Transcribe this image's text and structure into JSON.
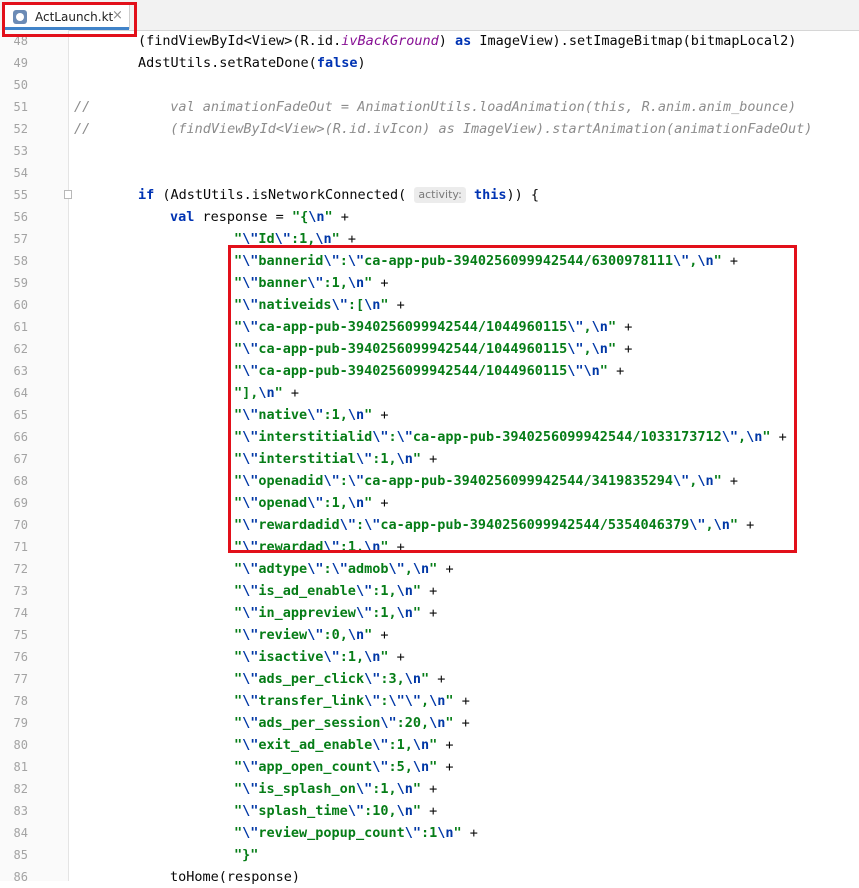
{
  "tab": {
    "filename": "ActLaunch.kt",
    "close": "×"
  },
  "lines": [
    {
      "n": "48",
      "parts": [
        [
          "",
          "(findViewById<View>(R.id."
        ],
        [
          "ital",
          "ivBackGround"
        ],
        [
          "",
          ") "
        ],
        [
          "kw",
          "as"
        ],
        [
          "",
          " ImageView).setImageBitmap(bitmapLocal2)"
        ]
      ]
    },
    {
      "n": "49",
      "parts": [
        [
          "",
          "AdstUtils.setRateDone("
        ],
        [
          "kw",
          "false"
        ],
        [
          "",
          ")"
        ]
      ]
    },
    {
      "n": "50",
      "parts": []
    },
    {
      "n": "51",
      "comment": "//",
      "parts": [
        [
          "cmt",
          "  val animationFadeOut = AnimationUtils.loadAnimation(this, R.anim.anim_bounce)"
        ]
      ]
    },
    {
      "n": "52",
      "comment": "//",
      "parts": [
        [
          "cmt",
          "  (findViewById<View>(R.id.ivIcon) as ImageView).startAnimation(animationFadeOut)"
        ]
      ]
    },
    {
      "n": "53",
      "parts": []
    },
    {
      "n": "54",
      "parts": []
    },
    {
      "n": "55",
      "fold": true,
      "parts": [
        [
          "kw",
          "if"
        ],
        [
          "",
          " (AdstUtils.isNetworkConnected( "
        ],
        [
          "hint",
          "activity:"
        ],
        [
          "",
          ""
        ],
        [
          "kw",
          " this"
        ],
        [
          "",
          "))"
        ],
        [
          "",
          " {"
        ]
      ]
    },
    {
      "n": "56",
      "indent": 1,
      "parts": [
        [
          "kw",
          "val"
        ],
        [
          "",
          " response = "
        ],
        [
          "str",
          "\"{"
        ],
        [
          "esc",
          "\\n"
        ],
        [
          "str",
          "\""
        ],
        [
          "",
          " +"
        ]
      ]
    },
    {
      "n": "57",
      "indent": 3,
      "parts": [
        [
          "str",
          "\""
        ],
        [
          "esc",
          "\\\""
        ],
        [
          "str",
          "Id"
        ],
        [
          "esc",
          "\\\""
        ],
        [
          "str",
          ":1,"
        ],
        [
          "esc",
          "\\n"
        ],
        [
          "str",
          "\""
        ],
        [
          "",
          " +"
        ]
      ]
    },
    {
      "n": "58",
      "indent": 3,
      "parts": [
        [
          "str",
          "\""
        ],
        [
          "esc",
          "\\\""
        ],
        [
          "str",
          "bannerid"
        ],
        [
          "esc",
          "\\\""
        ],
        [
          "str",
          ":"
        ],
        [
          "esc",
          "\\\""
        ],
        [
          "str",
          "ca-app-pub-3940256099942544/6300978111"
        ],
        [
          "esc",
          "\\\""
        ],
        [
          "str",
          ","
        ],
        [
          "esc",
          "\\n"
        ],
        [
          "str",
          "\""
        ],
        [
          "",
          " +"
        ]
      ]
    },
    {
      "n": "59",
      "indent": 3,
      "parts": [
        [
          "str",
          "\""
        ],
        [
          "esc",
          "\\\""
        ],
        [
          "str",
          "banner"
        ],
        [
          "esc",
          "\\\""
        ],
        [
          "str",
          ":1,"
        ],
        [
          "esc",
          "\\n"
        ],
        [
          "str",
          "\""
        ],
        [
          "",
          " +"
        ]
      ]
    },
    {
      "n": "60",
      "indent": 3,
      "parts": [
        [
          "str",
          "\""
        ],
        [
          "esc",
          "\\\""
        ],
        [
          "str",
          "nativeids"
        ],
        [
          "esc",
          "\\\""
        ],
        [
          "str",
          ":["
        ],
        [
          "esc",
          "\\n"
        ],
        [
          "str",
          "\""
        ],
        [
          "",
          " +"
        ]
      ]
    },
    {
      "n": "61",
      "indent": 3,
      "parts": [
        [
          "str",
          "\""
        ],
        [
          "esc",
          "\\\""
        ],
        [
          "str",
          "ca-app-pub-3940256099942544/1044960115"
        ],
        [
          "esc",
          "\\\""
        ],
        [
          "str",
          ","
        ],
        [
          "esc",
          "\\n"
        ],
        [
          "str",
          "\""
        ],
        [
          "",
          " +"
        ]
      ]
    },
    {
      "n": "62",
      "indent": 3,
      "parts": [
        [
          "str",
          "\""
        ],
        [
          "esc",
          "\\\""
        ],
        [
          "str",
          "ca-app-pub-3940256099942544/1044960115"
        ],
        [
          "esc",
          "\\\""
        ],
        [
          "str",
          ","
        ],
        [
          "esc",
          "\\n"
        ],
        [
          "str",
          "\""
        ],
        [
          "",
          " +"
        ]
      ]
    },
    {
      "n": "63",
      "indent": 3,
      "parts": [
        [
          "str",
          "\""
        ],
        [
          "esc",
          "\\\""
        ],
        [
          "str",
          "ca-app-pub-3940256099942544/1044960115"
        ],
        [
          "esc",
          "\\\""
        ],
        [
          "esc",
          "\\n"
        ],
        [
          "str",
          "\""
        ],
        [
          "",
          " +"
        ]
      ]
    },
    {
      "n": "64",
      "indent": 3,
      "parts": [
        [
          "str",
          "\"],"
        ],
        [
          "esc",
          "\\n"
        ],
        [
          "str",
          "\""
        ],
        [
          "",
          " +"
        ]
      ]
    },
    {
      "n": "65",
      "indent": 3,
      "parts": [
        [
          "str",
          "\""
        ],
        [
          "esc",
          "\\\""
        ],
        [
          "str",
          "native"
        ],
        [
          "esc",
          "\\\""
        ],
        [
          "str",
          ":1,"
        ],
        [
          "esc",
          "\\n"
        ],
        [
          "str",
          "\""
        ],
        [
          "",
          " +"
        ]
      ]
    },
    {
      "n": "66",
      "indent": 3,
      "parts": [
        [
          "str",
          "\""
        ],
        [
          "esc",
          "\\\""
        ],
        [
          "str",
          "interstitialid"
        ],
        [
          "esc",
          "\\\""
        ],
        [
          "str",
          ":"
        ],
        [
          "esc",
          "\\\""
        ],
        [
          "str",
          "ca-app-pub-3940256099942544/1033173712"
        ],
        [
          "esc",
          "\\\""
        ],
        [
          "str",
          ","
        ],
        [
          "esc",
          "\\n"
        ],
        [
          "str",
          "\""
        ],
        [
          "",
          " +"
        ]
      ]
    },
    {
      "n": "67",
      "indent": 3,
      "parts": [
        [
          "str",
          "\""
        ],
        [
          "esc",
          "\\\""
        ],
        [
          "str",
          "interstitial"
        ],
        [
          "esc",
          "\\\""
        ],
        [
          "str",
          ":1,"
        ],
        [
          "esc",
          "\\n"
        ],
        [
          "str",
          "\""
        ],
        [
          "",
          " +"
        ]
      ]
    },
    {
      "n": "68",
      "indent": 3,
      "parts": [
        [
          "str",
          "\""
        ],
        [
          "esc",
          "\\\""
        ],
        [
          "str",
          "openadid"
        ],
        [
          "esc",
          "\\\""
        ],
        [
          "str",
          ":"
        ],
        [
          "esc",
          "\\\""
        ],
        [
          "str",
          "ca-app-pub-3940256099942544/3419835294"
        ],
        [
          "esc",
          "\\\""
        ],
        [
          "str",
          ","
        ],
        [
          "esc",
          "\\n"
        ],
        [
          "str",
          "\""
        ],
        [
          "",
          " +"
        ]
      ]
    },
    {
      "n": "69",
      "indent": 3,
      "parts": [
        [
          "str",
          "\""
        ],
        [
          "esc",
          "\\\""
        ],
        [
          "str",
          "openad"
        ],
        [
          "esc",
          "\\\""
        ],
        [
          "str",
          ":1,"
        ],
        [
          "esc",
          "\\n"
        ],
        [
          "str",
          "\""
        ],
        [
          "",
          " +"
        ]
      ]
    },
    {
      "n": "70",
      "indent": 3,
      "parts": [
        [
          "str",
          "\""
        ],
        [
          "esc",
          "\\\""
        ],
        [
          "str",
          "rewardadid"
        ],
        [
          "esc",
          "\\\""
        ],
        [
          "str",
          ":"
        ],
        [
          "esc",
          "\\\""
        ],
        [
          "str",
          "ca-app-pub-3940256099942544/5354046379"
        ],
        [
          "esc",
          "\\\""
        ],
        [
          "str",
          ","
        ],
        [
          "esc",
          "\\n"
        ],
        [
          "str",
          "\""
        ],
        [
          "",
          " +"
        ]
      ]
    },
    {
      "n": "71",
      "indent": 3,
      "parts": [
        [
          "str",
          "\""
        ],
        [
          "esc",
          "\\\""
        ],
        [
          "str",
          "rewardad"
        ],
        [
          "esc",
          "\\\""
        ],
        [
          "str",
          ":1,"
        ],
        [
          "esc",
          "\\n"
        ],
        [
          "str",
          "\""
        ],
        [
          "",
          " +"
        ]
      ]
    },
    {
      "n": "72",
      "indent": 3,
      "parts": [
        [
          "str",
          "\""
        ],
        [
          "esc",
          "\\\""
        ],
        [
          "str",
          "adtype"
        ],
        [
          "esc",
          "\\\""
        ],
        [
          "str",
          ":"
        ],
        [
          "esc",
          "\\\""
        ],
        [
          "str",
          "admob"
        ],
        [
          "esc",
          "\\\""
        ],
        [
          "str",
          ","
        ],
        [
          "esc",
          "\\n"
        ],
        [
          "str",
          "\""
        ],
        [
          "",
          " +"
        ]
      ]
    },
    {
      "n": "73",
      "indent": 3,
      "parts": [
        [
          "str",
          "\""
        ],
        [
          "esc",
          "\\\""
        ],
        [
          "str",
          "is_ad_enable"
        ],
        [
          "esc",
          "\\\""
        ],
        [
          "str",
          ":1,"
        ],
        [
          "esc",
          "\\n"
        ],
        [
          "str",
          "\""
        ],
        [
          "",
          " +"
        ]
      ]
    },
    {
      "n": "74",
      "indent": 3,
      "parts": [
        [
          "str",
          "\""
        ],
        [
          "esc",
          "\\\""
        ],
        [
          "str",
          "in_appreview"
        ],
        [
          "esc",
          "\\\""
        ],
        [
          "str",
          ":1,"
        ],
        [
          "esc",
          "\\n"
        ],
        [
          "str",
          "\""
        ],
        [
          "",
          " +"
        ]
      ]
    },
    {
      "n": "75",
      "indent": 3,
      "parts": [
        [
          "str",
          "\""
        ],
        [
          "esc",
          "\\\""
        ],
        [
          "str",
          "review"
        ],
        [
          "esc",
          "\\\""
        ],
        [
          "str",
          ":0,"
        ],
        [
          "esc",
          "\\n"
        ],
        [
          "str",
          "\""
        ],
        [
          "",
          " +"
        ]
      ]
    },
    {
      "n": "76",
      "indent": 3,
      "parts": [
        [
          "str",
          "\""
        ],
        [
          "esc",
          "\\\""
        ],
        [
          "str",
          "isactive"
        ],
        [
          "esc",
          "\\\""
        ],
        [
          "str",
          ":1,"
        ],
        [
          "esc",
          "\\n"
        ],
        [
          "str",
          "\""
        ],
        [
          "",
          " +"
        ]
      ]
    },
    {
      "n": "77",
      "indent": 3,
      "parts": [
        [
          "str",
          "\""
        ],
        [
          "esc",
          "\\\""
        ],
        [
          "str",
          "ads_per_click"
        ],
        [
          "esc",
          "\\\""
        ],
        [
          "str",
          ":3,"
        ],
        [
          "esc",
          "\\n"
        ],
        [
          "str",
          "\""
        ],
        [
          "",
          " +"
        ]
      ]
    },
    {
      "n": "78",
      "indent": 3,
      "parts": [
        [
          "str",
          "\""
        ],
        [
          "esc",
          "\\\""
        ],
        [
          "str",
          "transfer_link"
        ],
        [
          "esc",
          "\\\""
        ],
        [
          "str",
          ":"
        ],
        [
          "esc",
          "\\\""
        ],
        [
          "esc",
          "\\\""
        ],
        [
          "str",
          ","
        ],
        [
          "esc",
          "\\n"
        ],
        [
          "str",
          "\""
        ],
        [
          "",
          " +"
        ]
      ]
    },
    {
      "n": "79",
      "indent": 3,
      "parts": [
        [
          "str",
          "\""
        ],
        [
          "esc",
          "\\\""
        ],
        [
          "str",
          "ads_per_session"
        ],
        [
          "esc",
          "\\\""
        ],
        [
          "str",
          ":20,"
        ],
        [
          "esc",
          "\\n"
        ],
        [
          "str",
          "\""
        ],
        [
          "",
          " +"
        ]
      ]
    },
    {
      "n": "80",
      "indent": 3,
      "parts": [
        [
          "str",
          "\""
        ],
        [
          "esc",
          "\\\""
        ],
        [
          "str",
          "exit_ad_enable"
        ],
        [
          "esc",
          "\\\""
        ],
        [
          "str",
          ":1,"
        ],
        [
          "esc",
          "\\n"
        ],
        [
          "str",
          "\""
        ],
        [
          "",
          " +"
        ]
      ]
    },
    {
      "n": "81",
      "indent": 3,
      "parts": [
        [
          "str",
          "\""
        ],
        [
          "esc",
          "\\\""
        ],
        [
          "str",
          "app_open_count"
        ],
        [
          "esc",
          "\\\""
        ],
        [
          "str",
          ":5,"
        ],
        [
          "esc",
          "\\n"
        ],
        [
          "str",
          "\""
        ],
        [
          "",
          " +"
        ]
      ]
    },
    {
      "n": "82",
      "indent": 3,
      "parts": [
        [
          "str",
          "\""
        ],
        [
          "esc",
          "\\\""
        ],
        [
          "str",
          "is_splash_on"
        ],
        [
          "esc",
          "\\\""
        ],
        [
          "str",
          ":1,"
        ],
        [
          "esc",
          "\\n"
        ],
        [
          "str",
          "\""
        ],
        [
          "",
          " +"
        ]
      ]
    },
    {
      "n": "83",
      "indent": 3,
      "parts": [
        [
          "str",
          "\""
        ],
        [
          "esc",
          "\\\""
        ],
        [
          "str",
          "splash_time"
        ],
        [
          "esc",
          "\\\""
        ],
        [
          "str",
          ":10,"
        ],
        [
          "esc",
          "\\n"
        ],
        [
          "str",
          "\""
        ],
        [
          "",
          " +"
        ]
      ]
    },
    {
      "n": "84",
      "indent": 3,
      "parts": [
        [
          "str",
          "\""
        ],
        [
          "esc",
          "\\\""
        ],
        [
          "str",
          "review_popup_count"
        ],
        [
          "esc",
          "\\\""
        ],
        [
          "str",
          ":1"
        ],
        [
          "esc",
          "\\n"
        ],
        [
          "str",
          "\""
        ],
        [
          "",
          " +"
        ]
      ]
    },
    {
      "n": "85",
      "indent": 3,
      "parts": [
        [
          "str",
          "\"}\""
        ]
      ]
    },
    {
      "n": "86",
      "indent": 1,
      "parts": [
        [
          "",
          "toHome(response)"
        ]
      ]
    }
  ]
}
